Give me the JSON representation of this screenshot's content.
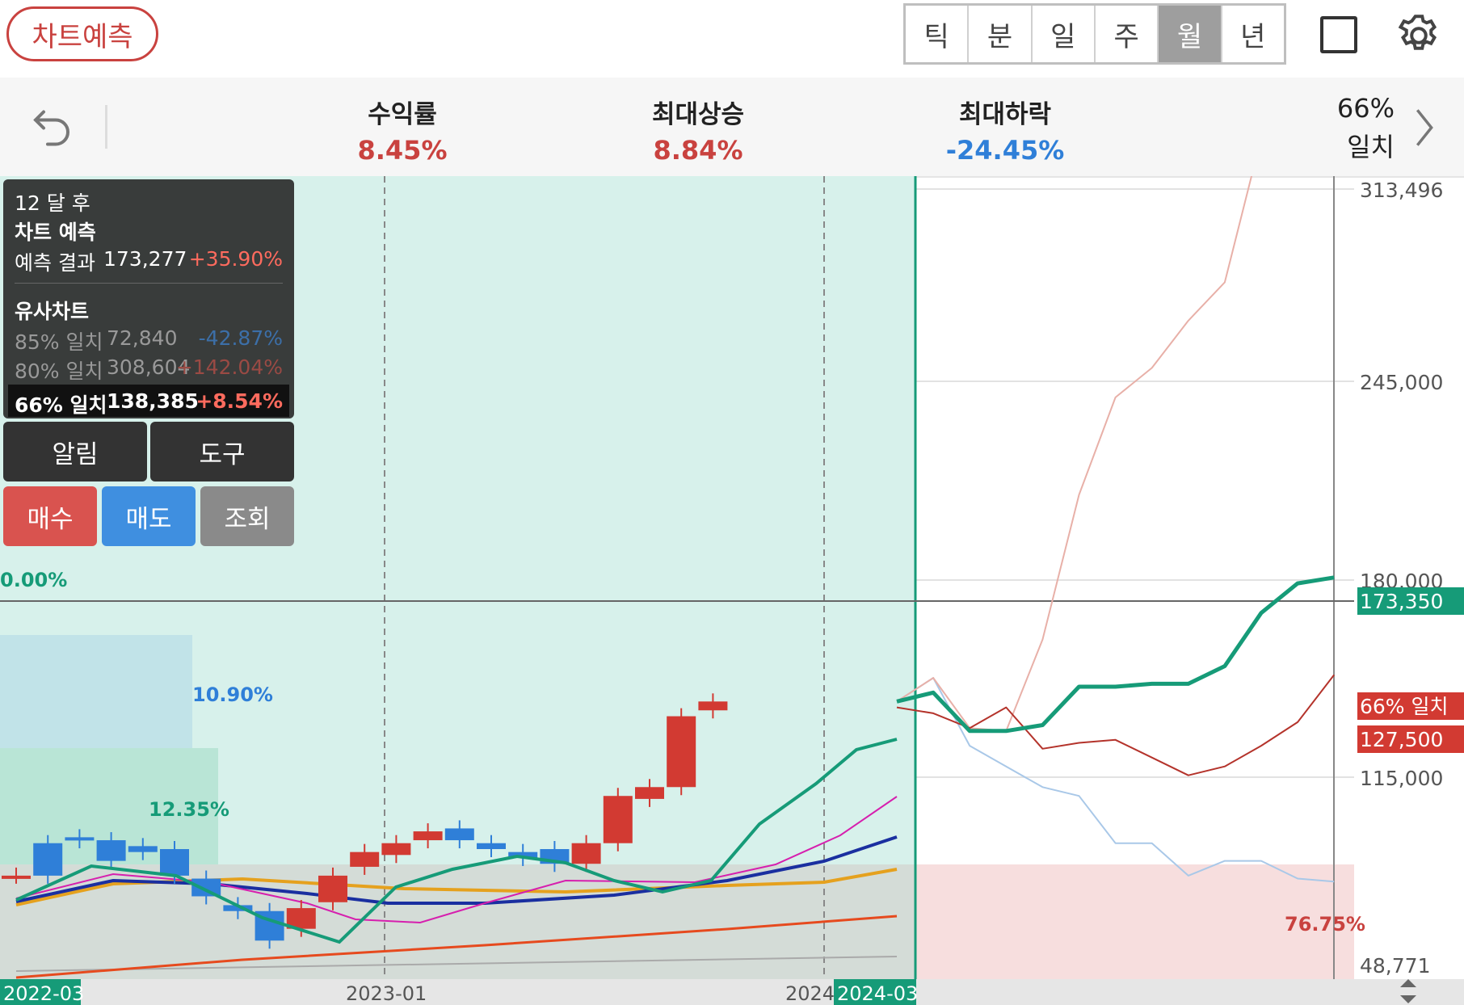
{
  "toolbar": {
    "predict_label": "차트예측",
    "periods": [
      "틱",
      "분",
      "일",
      "주",
      "월",
      "년"
    ],
    "active_period": "월"
  },
  "stats": {
    "return_label": "수익률",
    "return_value": "8.45%",
    "max_up_label": "최대상승",
    "max_up_value": "8.84%",
    "max_down_label": "최대하락",
    "max_down_value": "-24.45%",
    "match_percent": "66%",
    "match_label": "일치"
  },
  "colors": {
    "up": "#d23a32",
    "down": "#2f7fd8",
    "forecast": "#169b78",
    "accent": "#c9423f"
  },
  "overlay": {
    "header": "12 달 후",
    "title": "차트 예측",
    "result_label": "예측 결과",
    "result_value": "173,277",
    "result_change": "+35.90%",
    "similar_title": "유사차트",
    "similar": [
      {
        "match": "85% 일치",
        "value": "72,840",
        "change": "-42.87%"
      },
      {
        "match": "80% 일치",
        "value": "308,604",
        "change": "+142.04%"
      },
      {
        "match": "66% 일치",
        "value": "138,385",
        "change": "+8.54%"
      }
    ]
  },
  "buttons": {
    "alert": "알림",
    "tools": "도구",
    "buy": "매수",
    "sell": "매도",
    "view": "조회"
  },
  "chart": {
    "y_ticks": [
      "313,496",
      "245,000",
      "180,000",
      "115,000",
      "48,771"
    ],
    "current_price": "173,350",
    "match_tag": "66% 일치",
    "match_price": "127,500",
    "left_labels": [
      "0.00%",
      "10.90%",
      "12.35%"
    ],
    "down_zone_label": "76.75%",
    "x_labels": [
      "2022-03",
      "2023-01",
      "2024",
      "2024-03"
    ]
  },
  "chart_data": {
    "type": "candlestick",
    "period": "monthly",
    "y_axis_ticks": [
      313496,
      245000,
      180000,
      115000,
      48771
    ],
    "candles": [
      {
        "o": 80000,
        "c": 80000
      },
      {
        "o": 91000,
        "c": 80000
      },
      {
        "o": 93000,
        "c": 92000
      },
      {
        "o": 92000,
        "c": 85000
      },
      {
        "o": 90000,
        "c": 88000
      },
      {
        "o": 89000,
        "c": 80000
      },
      {
        "o": 79000,
        "c": 73000
      },
      {
        "o": 70000,
        "c": 68000
      },
      {
        "o": 68000,
        "c": 58000
      },
      {
        "o": 62000,
        "c": 69000
      },
      {
        "o": 71000,
        "c": 80000
      },
      {
        "o": 83000,
        "c": 88000
      },
      {
        "o": 87000,
        "c": 91000
      },
      {
        "o": 92000,
        "c": 95000
      },
      {
        "o": 96000,
        "c": 92000
      },
      {
        "o": 91000,
        "c": 89000
      },
      {
        "o": 88000,
        "c": 86000
      },
      {
        "o": 89000,
        "c": 84000
      },
      {
        "o": 84000,
        "c": 91000
      },
      {
        "o": 91000,
        "c": 107000
      },
      {
        "o": 106000,
        "c": 110000
      },
      {
        "o": 110000,
        "c": 134000
      },
      {
        "o": 136000,
        "c": 139000
      }
    ],
    "forecast_series": [
      {
        "name": "66% 일치",
        "values": [
          139000,
          142000,
          129000,
          129000,
          131000,
          144000,
          144000,
          145000,
          145000,
          151000,
          169000,
          179000,
          181000
        ]
      },
      {
        "values": [
          137000,
          135000,
          130000,
          137000,
          123000,
          125000,
          126000,
          120000,
          114000,
          117000,
          124000,
          132000,
          148000
        ]
      },
      {
        "values": [
          139000,
          147000,
          130000,
          129000,
          160000,
          209000,
          242000,
          252000,
          268000,
          281000,
          330000,
          370000,
          360000
        ]
      },
      {
        "values": [
          139000,
          147000,
          124000,
          117000,
          110000,
          107000,
          91000,
          91000,
          80000,
          85000,
          85000,
          79000,
          78000
        ]
      }
    ]
  }
}
